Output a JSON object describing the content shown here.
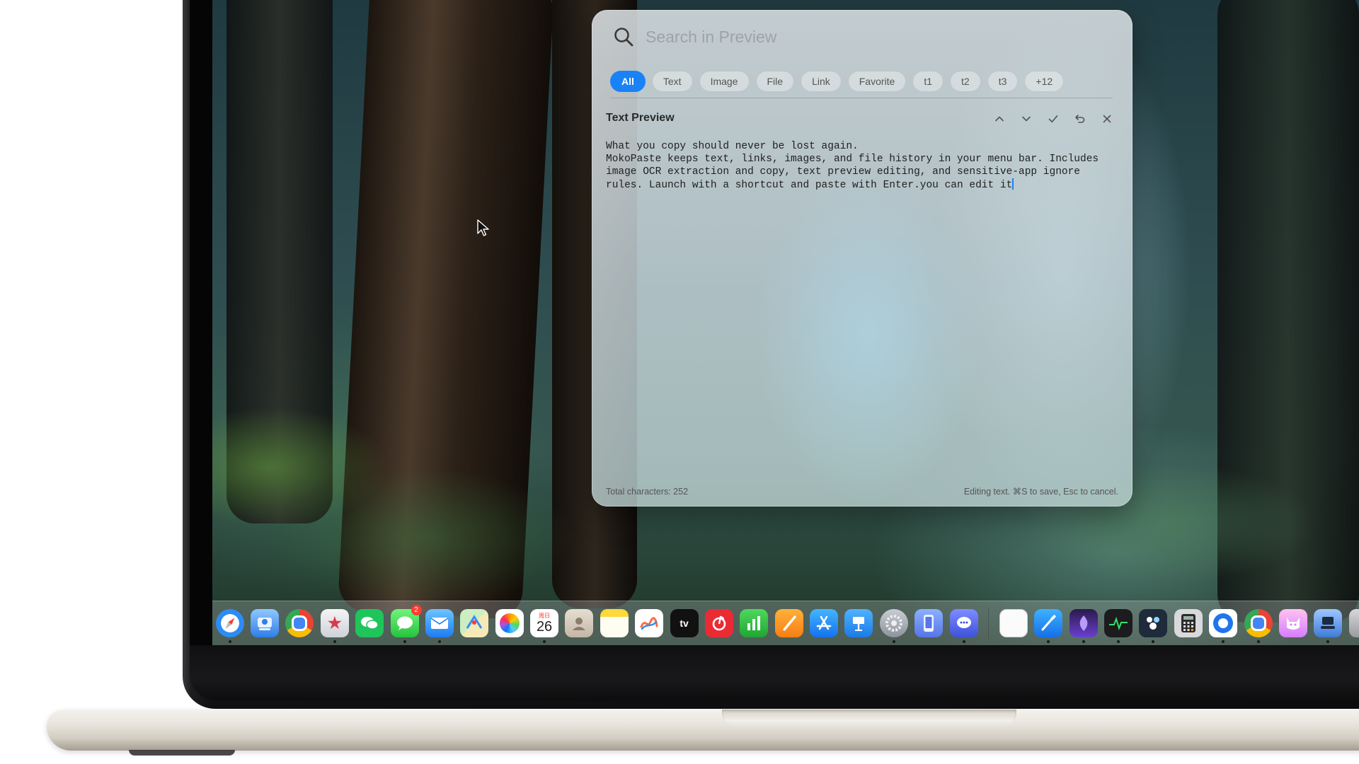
{
  "panel": {
    "search_placeholder": "Search in Preview",
    "tabs": [
      {
        "label": "All",
        "active": true
      },
      {
        "label": "Text"
      },
      {
        "label": "Image"
      },
      {
        "label": "File"
      },
      {
        "label": "Link"
      },
      {
        "label": "Favorite"
      },
      {
        "label": "t1"
      },
      {
        "label": "t2"
      },
      {
        "label": "t3"
      },
      {
        "label": "+12"
      }
    ],
    "preview_title": "Text Preview",
    "preview_text": "What you copy should never be lost again.\nMokoPaste keeps text, links, images, and file history in your menu bar. Includes\nimage OCR extraction and copy, text preview editing, and sensitive-app ignore\nrules. Launch with a shortcut and paste with Enter.you can edit it",
    "footer_left": "Total characters: 252",
    "footer_right": "Editing text. ⌘S to save, Esc to cancel.",
    "accent_color": "#1a82f7"
  },
  "dock": {
    "calendar_day": "26",
    "calendar_month": "周日",
    "messages_badge": "2",
    "tv_label": "tv",
    "apps": [
      "safari-icon",
      "finder-style-icon",
      "chrome-icon",
      "launch-icon",
      "wechat-icon",
      "messages-icon",
      "mail-icon",
      "maps-icon",
      "photos-icon",
      "calendar-icon",
      "contacts-icon",
      "notes-icon",
      "freeform-icon",
      "apple-tv-icon",
      "netease-music-icon",
      "numbers-icon",
      "pages-icon",
      "app-store-icon",
      "keynote-icon",
      "system-settings-icon",
      "iphone-mirroring-icon",
      "chat-app-icon",
      "textedit-icon",
      "xcode-icon",
      "ai-app-icon",
      "activity-monitor-icon",
      "puzzle-app-icon",
      "calculator-icon",
      "signal-app-icon",
      "chrome-alt-icon",
      "cat-app-icon",
      "migration-icon",
      "partial-app-icon"
    ]
  }
}
